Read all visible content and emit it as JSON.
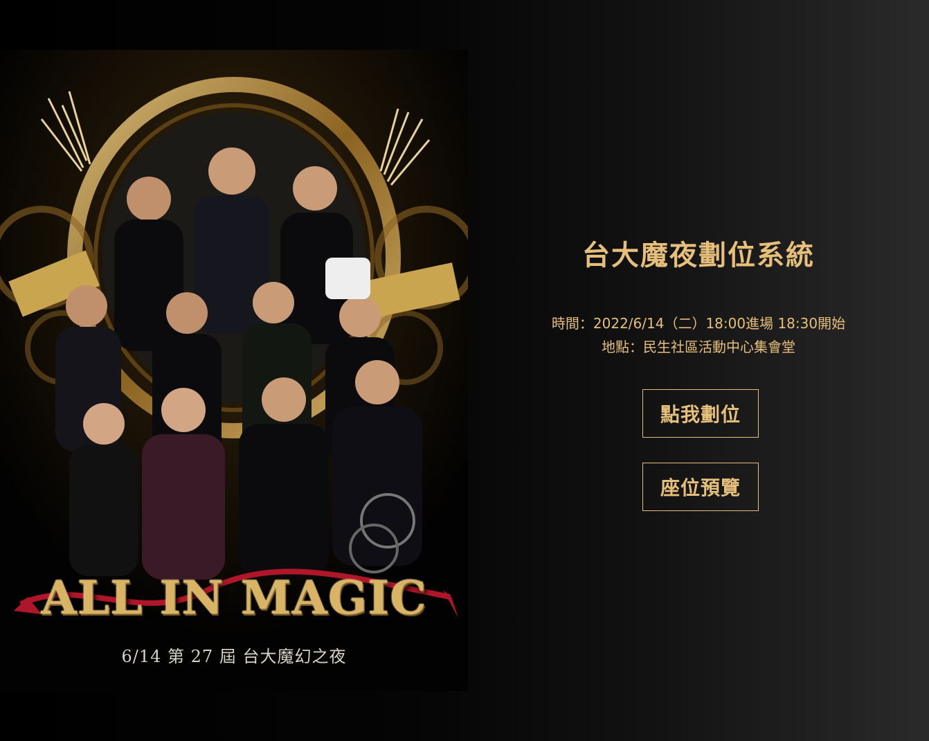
{
  "poster": {
    "title": "ALL IN MAGIC",
    "subtitle": "6/14  第 27 屆 台大魔幻之夜"
  },
  "main": {
    "title": "台大魔夜劃位系統",
    "time_line": "時間：2022/6/14（二）18:00進場 18:30開始",
    "venue_line": "地點：民生社區活動中心集會堂",
    "reserve_label": "點我劃位",
    "preview_label": "座位預覽"
  },
  "colors": {
    "accent": "#e6bf7a",
    "background": "#000000"
  }
}
